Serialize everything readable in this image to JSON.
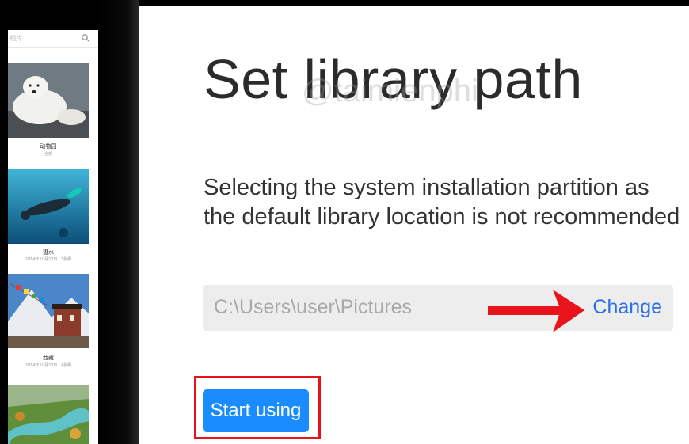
{
  "preview": {
    "search_placeholder": "相片",
    "albums": [
      {
        "title": "动物园",
        "subtitle": "全部"
      },
      {
        "title": "潜水",
        "subtitle": "2014年10月20日 · 3张照"
      },
      {
        "title": "西藏",
        "subtitle": "2014年10月20日 · 4张照"
      }
    ]
  },
  "dialog": {
    "title": "Set library path",
    "watermark": "@taimienphi",
    "description": "Selecting the system installation partition as the default library location is not recommended",
    "path_value": "C:\\Users\\user\\Pictures",
    "change_label": "Change",
    "start_label": "Start using"
  },
  "colors": {
    "accent": "#1a8cff",
    "link": "#2a6fe6",
    "annotation": "#e8131b"
  }
}
